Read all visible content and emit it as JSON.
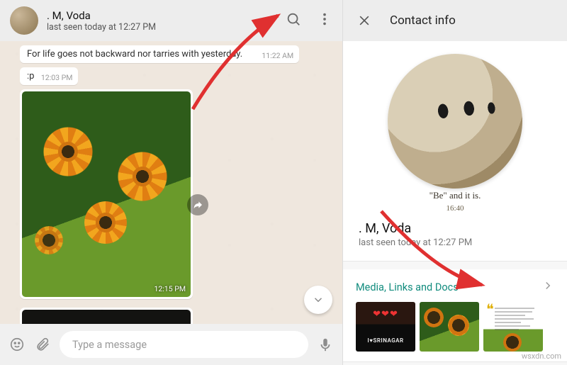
{
  "chat": {
    "header": {
      "contact_name": ". M, Voda",
      "last_seen": "last seen today at 12:27 PM",
      "search_icon": "search",
      "menu_icon": "more-vertical"
    },
    "messages": {
      "quoted_text": "For life goes not backward nor tarries with yesterday.",
      "quoted_time": "11:22 AM",
      "p_text": ":p",
      "p_time": "12:03 PM",
      "photo_time": "12:15 PM"
    },
    "composer": {
      "emoji_icon": "smiley",
      "attach_icon": "paperclip",
      "placeholder": "Type a message",
      "mic_icon": "microphone"
    },
    "scroll_down_icon": "chevron-down",
    "forward_icon": "share-forward"
  },
  "info": {
    "close_icon": "close",
    "title": "Contact info",
    "avatar_caption": "\"Be\" and it is.",
    "avatar_caption_sub": "16:40",
    "contact_name": ". M, Voda",
    "last_seen": "last seen today at 12:27 PM",
    "media_section_title": "Media, Links and Docs",
    "chevron_icon": "chevron-right"
  },
  "watermark": "wsxdn.com",
  "colors": {
    "accent_teal": "#128c7e",
    "header_bg": "#ededed",
    "chat_bg": "#efe7de",
    "annotation_red": "#e03030"
  }
}
